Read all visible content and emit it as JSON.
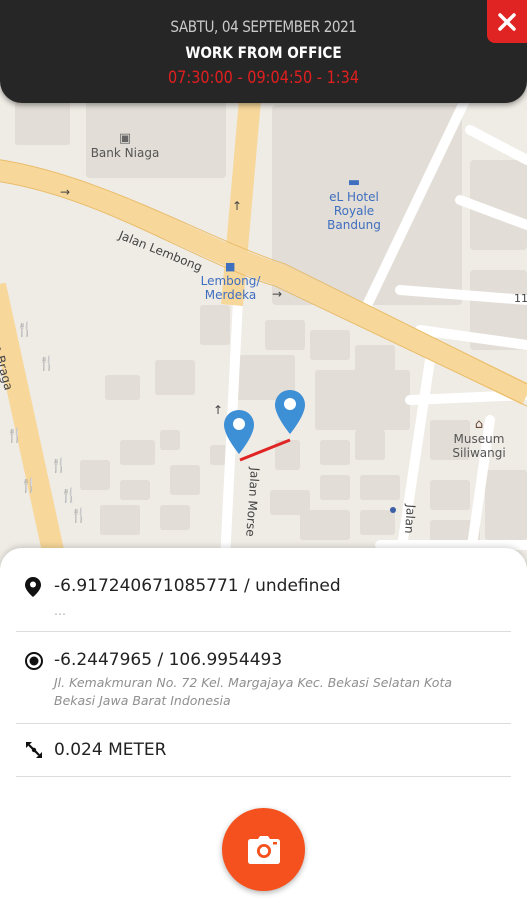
{
  "header": {
    "date": "SABTU, 04 SEPTEMBER 2021",
    "mode": "WORK FROM OFFICE",
    "times": "07:30:00 - 09:04:50 - 1:34",
    "close_icon": "close-icon"
  },
  "map": {
    "poi": {
      "bank": "Bank Niaga",
      "hotel_line1": "eL Hotel",
      "hotel_line2": "Royale",
      "hotel_line3": "Bandung",
      "bus_line1": "Lembong/",
      "bus_line2": "Merdeka",
      "museum_line1": "Museum",
      "museum_line2": "Siliwangi"
    },
    "roads": {
      "lembong": "Jalan Lembong",
      "braga": "Jalan Braga",
      "morse": "Jalan Morse",
      "jalan": "Jalan",
      "edge_left": "ksi",
      "edge_right": "11"
    }
  },
  "info": {
    "target": {
      "coords": "-6.917240671085771 / undefined",
      "address": "..."
    },
    "current": {
      "coords": "-6.2447965 / 106.9954493",
      "address": "Jl. Kemakmuran No. 72 Kel. Margajaya Kec. Bekasi Selatan Kota Bekasi Jawa Barat Indonesia"
    },
    "distance": {
      "value": "0.024 METER"
    }
  },
  "colors": {
    "header_bg": "#262626",
    "accent_red": "#e02424",
    "camera_orange": "#f4511e",
    "marker_blue": "#3d8fd6"
  }
}
